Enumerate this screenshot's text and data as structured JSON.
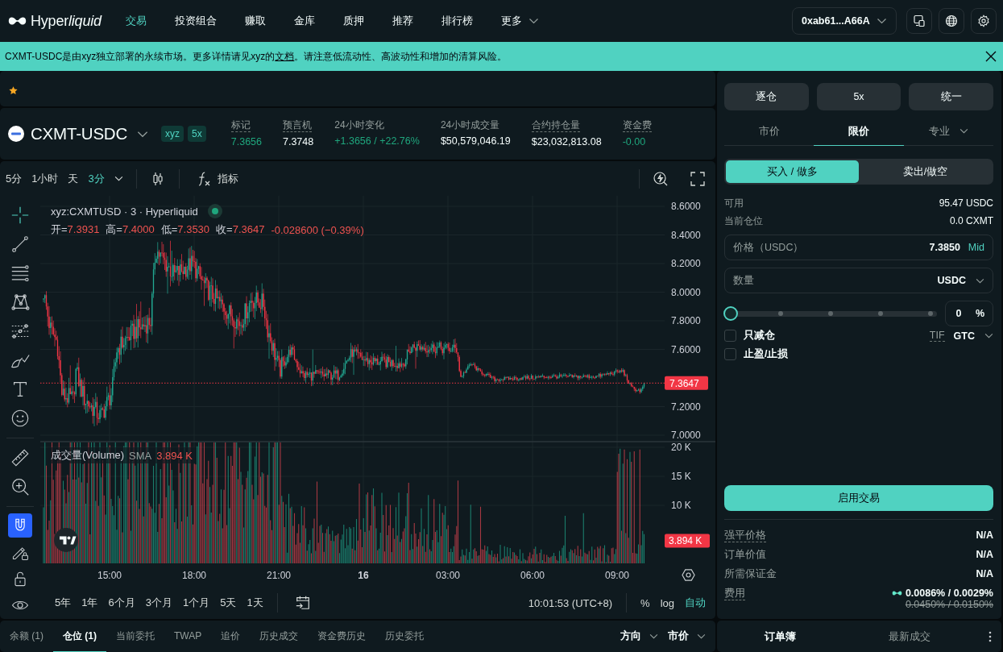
{
  "nav": {
    "brand": [
      {
        "text": "Hyper",
        "italic": false
      },
      {
        "text": "liquid",
        "italic": true
      }
    ],
    "links": [
      {
        "label": "交易",
        "selected": true,
        "has_menu": false
      },
      {
        "label": "投资组合",
        "selected": false,
        "has_menu": false
      },
      {
        "label": "赚取",
        "selected": false,
        "has_menu": false
      },
      {
        "label": "金库",
        "selected": false,
        "has_menu": false
      },
      {
        "label": "质押",
        "selected": false,
        "has_menu": false
      },
      {
        "label": "推荐",
        "selected": false,
        "has_menu": false
      },
      {
        "label": "排行榜",
        "selected": false,
        "has_menu": false
      },
      {
        "label": "更多",
        "selected": false,
        "has_menu": true
      }
    ],
    "wallet": "0xab61...A66A"
  },
  "banner": {
    "text_before": "CXMT-USDC是由xyz独立部署的永续市场。更多详情请见xyz的",
    "link": "文档",
    "text_after": "。请注意低流动性、高波动性和增加的清算风险。"
  },
  "market": {
    "symbol": "CXMT-USDC",
    "badges": [
      "xyz",
      "5x"
    ],
    "stats": [
      {
        "label": "标记",
        "value": "7.3656",
        "up": true,
        "has_tooltip": true
      },
      {
        "label": "预言机",
        "value": "7.3748",
        "up": false,
        "has_tooltip": true
      },
      {
        "label": "24小时变化",
        "value": "+1.3656 / +22.76%",
        "up": true,
        "has_tooltip": false
      },
      {
        "label": "24小时成交量",
        "value": "$50,579,046.19",
        "up": false,
        "has_tooltip": false
      },
      {
        "label": "合约持仓量",
        "value": "$23,032,813.08",
        "up": false,
        "has_tooltip": true
      },
      {
        "label": "资金费",
        "value": "-0.00",
        "up": true,
        "has_tooltip": true
      }
    ]
  },
  "chart": {
    "timeframes": [
      {
        "label": "5分",
        "selected": false
      },
      {
        "label": "1小时",
        "selected": false
      },
      {
        "label": "天",
        "selected": false
      },
      {
        "label": "3分",
        "selected": true
      }
    ],
    "indicators": "指标",
    "drawing_tools": [
      [
        {
          "kind": "crosshair",
          "selected": true
        },
        {
          "kind": "trend-line",
          "selected": false
        },
        {
          "kind": "fib-levels",
          "selected": false
        },
        {
          "kind": "pattern",
          "selected": false
        },
        {
          "kind": "projection",
          "selected": false
        },
        {
          "kind": "brush",
          "selected": false
        },
        {
          "kind": "text",
          "selected": false
        },
        {
          "kind": "emoji",
          "selected": false
        }
      ],
      [
        {
          "kind": "ruler",
          "selected": false
        },
        {
          "kind": "zoom-in",
          "selected": false
        }
      ]
    ],
    "toggles": [
      {
        "kind": "magnet",
        "on": true
      },
      {
        "kind": "lock-drawing",
        "on": false
      },
      {
        "kind": "lock",
        "on": false
      },
      {
        "kind": "visibility",
        "on": false
      }
    ],
    "down": true,
    "legend": {
      "title": "xyz:CXMTUSD · 3 · Hyperliquid",
      "ohlc": [
        {
          "label": "开=",
          "value": "7.3931"
        },
        {
          "label": "高=",
          "value": "7.4000"
        },
        {
          "label": "低=",
          "value": "7.3530"
        },
        {
          "label": "收=",
          "value": "7.3647"
        }
      ],
      "change": "-0.028600 (−0.39%)"
    },
    "price_axis": [
      "8.6000",
      "8.4000",
      "8.2000",
      "8.0000",
      "7.8000",
      "7.6000",
      "7.2000",
      "7.0000"
    ],
    "last_price": "7.3647",
    "volume_legend": {
      "title": "成交量(Volume)",
      "indicator": "SMA",
      "value": "3.894 K"
    },
    "volume_axis": [
      "20 K",
      "15 K",
      "10 K"
    ],
    "last_volume": "3.894 K",
    "time_axis": [
      {
        "label": "15:00",
        "kind": "time"
      },
      {
        "label": "18:00",
        "kind": "time"
      },
      {
        "label": "21:00",
        "kind": "time"
      },
      {
        "label": "16",
        "kind": "day"
      },
      {
        "label": "03:00",
        "kind": "time"
      },
      {
        "label": "06:00",
        "kind": "time"
      },
      {
        "label": "09:00",
        "kind": "time"
      }
    ],
    "ranges": [
      "5年",
      "1年",
      "6个月",
      "3个月",
      "1个月",
      "5天",
      "1天"
    ],
    "clock": "10:01:53 (UTC+8)",
    "scale_options": [
      {
        "label": "%",
        "selected": false
      },
      {
        "label": "log",
        "selected": false
      },
      {
        "label": "自动",
        "selected": true
      }
    ]
  },
  "bottom_tabs": [
    {
      "label": "余额 (1)",
      "selected": false
    },
    {
      "label": "仓位 (1)",
      "selected": true
    },
    {
      "label": "当前委托",
      "selected": false
    },
    {
      "label": "TWAP",
      "selected": false
    },
    {
      "label": "追价",
      "selected": false
    },
    {
      "label": "历史成交",
      "selected": false
    },
    {
      "label": "资金费历史",
      "selected": false
    },
    {
      "label": "历史委托",
      "selected": false
    }
  ],
  "bottom_filters": [
    "方向",
    "市价"
  ],
  "order_panel": {
    "margin_buttons": [
      "逐仓",
      "5x",
      "统一"
    ],
    "order_types": [
      {
        "label": "市价",
        "selected": false,
        "has_menu": false
      },
      {
        "label": "限价",
        "selected": true,
        "has_menu": false
      },
      {
        "label": "专业",
        "selected": false,
        "has_menu": true
      }
    ],
    "sides": [
      {
        "label": "买入 / 做多",
        "selected": true
      },
      {
        "label": "卖出/做空",
        "selected": false
      }
    ],
    "info": [
      {
        "label": "可用",
        "value": "95.47 USDC"
      },
      {
        "label": "当前仓位",
        "value": "0.0 CXMT"
      }
    ],
    "price_field": {
      "label": "价格（USDC）",
      "value": "7.3850",
      "action": "Mid"
    },
    "size_field": {
      "placeholder": "数量",
      "unit": "USDC"
    },
    "size_slider": {
      "level": 0,
      "percent": "0",
      "unit": "%"
    },
    "options": [
      {
        "label": "只减仓",
        "checked": false
      },
      {
        "label": "止盈/止损",
        "checked": false
      }
    ],
    "tif": {
      "label": "TIF",
      "value": "GTC"
    },
    "submit": "启用交易",
    "summary": [
      {
        "label": "强平价格",
        "value": "N/A",
        "has_tooltip": true
      },
      {
        "label": "订单价值",
        "value": "N/A",
        "has_tooltip": false
      },
      {
        "label": "所需保证金",
        "value": "N/A",
        "has_tooltip": false
      },
      {
        "label": "费用",
        "value": "0.0086% / 0.0029%",
        "was": "0.0450% / 0.0150%",
        "has_tooltip": true
      }
    ]
  },
  "book_tabs": [
    {
      "label": "订单簿",
      "selected": true
    },
    {
      "label": "最新成交",
      "selected": false
    }
  ]
}
